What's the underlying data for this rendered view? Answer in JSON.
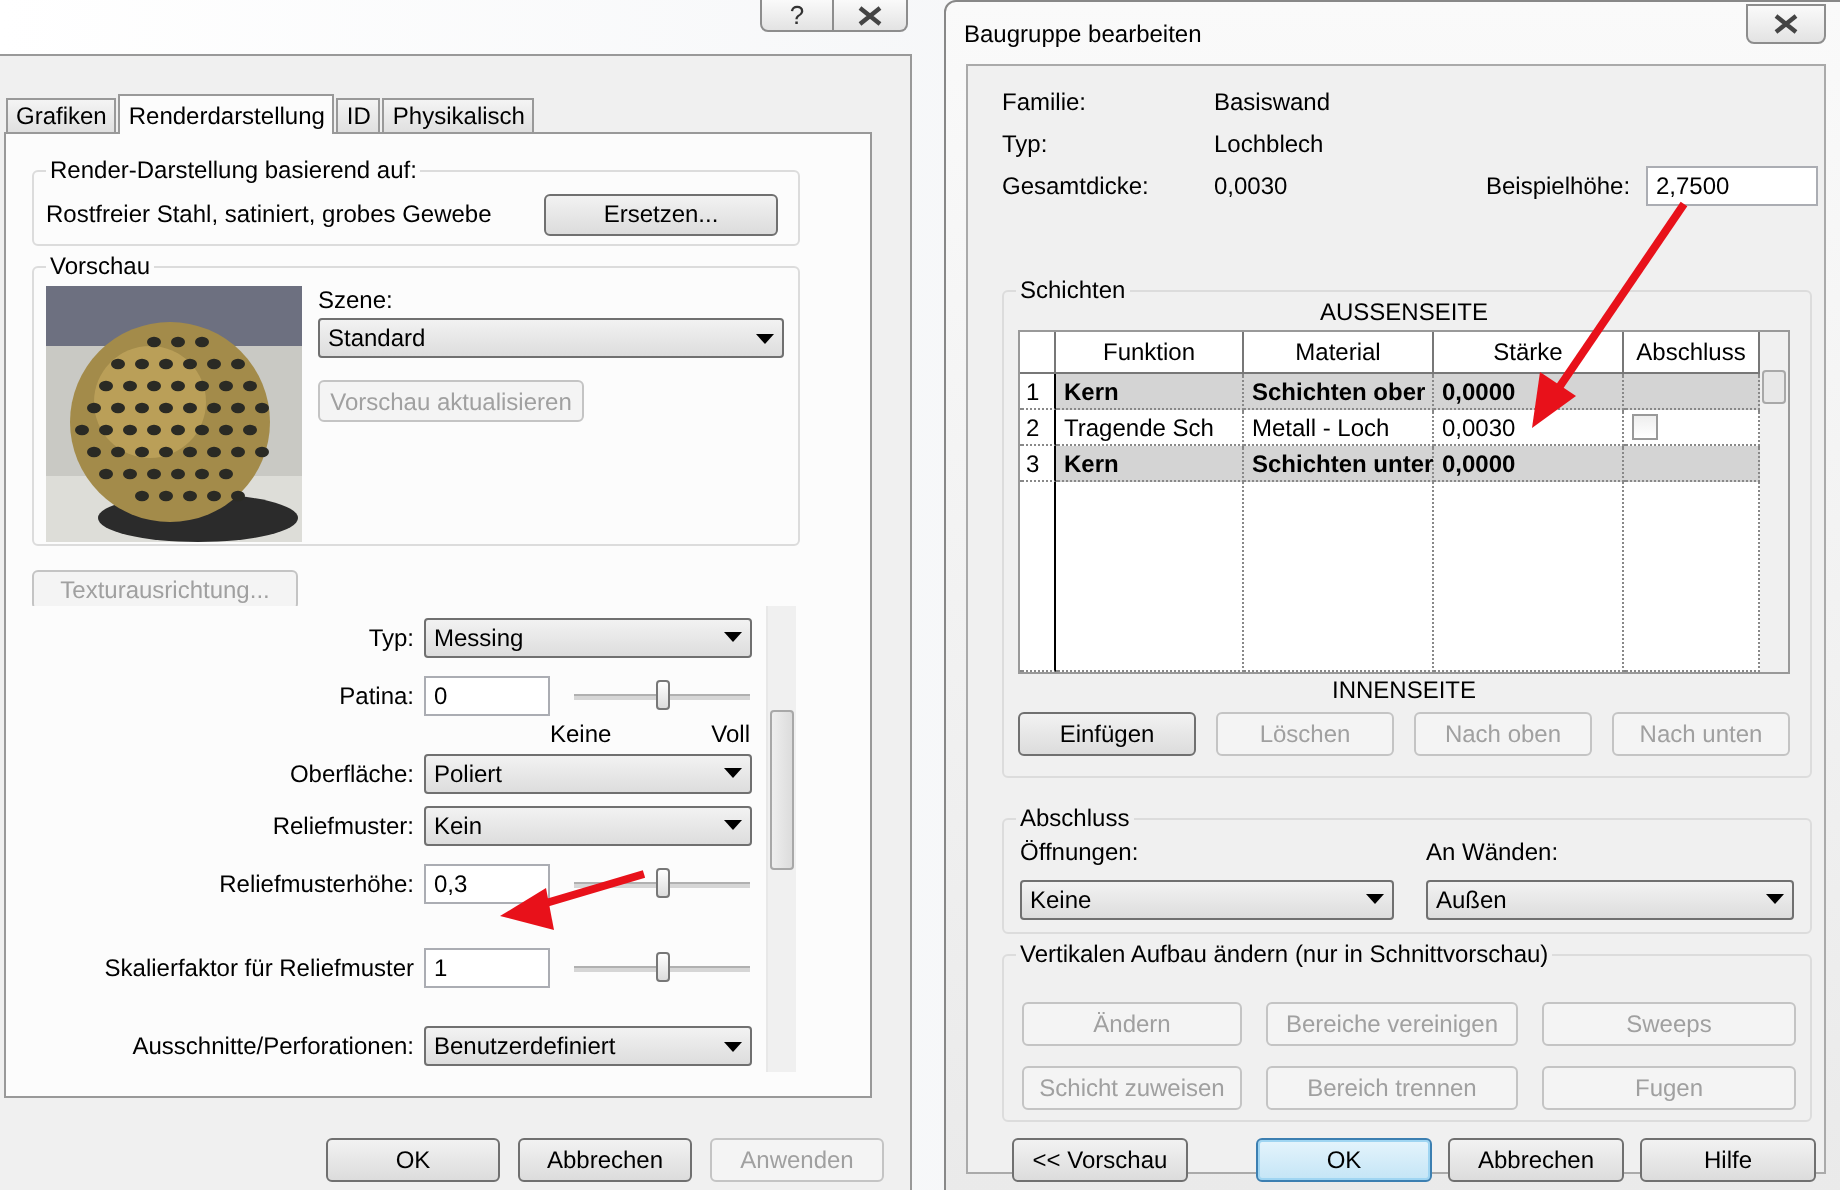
{
  "render_dialog": {
    "help_button": "?",
    "tabs": [
      {
        "label": "Grafiken",
        "selected": false
      },
      {
        "label": "Renderdarstellung",
        "selected": true
      },
      {
        "label": "ID",
        "selected": false
      },
      {
        "label": "Physikalisch",
        "selected": false
      }
    ],
    "based_on": {
      "legend": "Render-Darstellung basierend auf:",
      "value": "Rostfreier Stahl, satiniert, grobes Gewebe",
      "button": "Ersetzen..."
    },
    "preview": {
      "legend": "Vorschau",
      "scene_label": "Szene:",
      "scene": "Standard",
      "update_button": {
        "label": "Vorschau aktualisieren",
        "disabled": true
      }
    },
    "texture_button": {
      "label": "Texturausrichtung...",
      "disabled": true
    },
    "properties": [
      {
        "kind": "combo",
        "label": "Typ:",
        "value": "Messing"
      },
      {
        "kind": "slider",
        "label": "Patina:",
        "value": "0",
        "level": 0.5,
        "min_label": "Keine",
        "max_label": "Voll"
      },
      {
        "kind": "combo",
        "label": "Oberfläche:",
        "value": "Poliert"
      },
      {
        "kind": "combo",
        "label": "Reliefmuster:",
        "value": "Kein"
      },
      {
        "kind": "slider",
        "label": "Reliefmusterhöhe:",
        "value": "0,3",
        "level": 0.5
      },
      {
        "kind": "slider",
        "label": "Skalierfaktor für Reliefmuster",
        "value": "1",
        "level": 0.5
      },
      {
        "kind": "combo",
        "label": "Ausschnitte/Perforationen:",
        "value": "Benutzerdefiniert"
      }
    ],
    "buttons": [
      {
        "label": "OK",
        "disabled": false
      },
      {
        "label": "Abbrechen",
        "disabled": false
      },
      {
        "label": "Anwenden",
        "disabled": true
      }
    ]
  },
  "assembly_dialog": {
    "title": "Baugruppe bearbeiten",
    "info": [
      {
        "label": "Familie:",
        "value": "Basiswand"
      },
      {
        "label": "Typ:",
        "value": "Lochblech"
      },
      {
        "label": "Gesamtdicke:",
        "value": "0,0030"
      }
    ],
    "sample_height": {
      "label": "Beispielhöhe:",
      "value": "2,7500"
    },
    "layers": {
      "legend": "Schichten",
      "top_label": "AUSSENSEITE",
      "bottom_label": "INNENSEITE",
      "columns": [
        "Funktion",
        "Material",
        "Stärke",
        "Abschluss"
      ],
      "rows": [
        {
          "kind": "boundary",
          "number": "1",
          "function": "Kern",
          "material": "Schichten ober",
          "thickness": "0,0000"
        },
        {
          "kind": "layer",
          "number": "2",
          "function": "Tragende Sch",
          "material": "Metall - Loch",
          "thickness": "0,0030",
          "wraps": false
        },
        {
          "kind": "boundary",
          "number": "3",
          "function": "Kern",
          "material": "Schichten unter",
          "thickness": "0,0000"
        }
      ],
      "buttons": [
        {
          "label": "Einfügen",
          "disabled": false
        },
        {
          "label": "Löschen",
          "disabled": true
        },
        {
          "label": "Nach oben",
          "disabled": true
        },
        {
          "label": "Nach unten",
          "disabled": true
        }
      ]
    },
    "wrapping": {
      "legend": "Abschluss",
      "fields": [
        {
          "label": "Öffnungen:",
          "value": "Keine"
        },
        {
          "label": "An Wänden:",
          "value": "Außen"
        }
      ]
    },
    "vertical": {
      "legend": "Vertikalen Aufbau ändern (nur in Schnittvorschau)",
      "buttons": [
        {
          "label": "Ändern",
          "disabled": true
        },
        {
          "label": "Bereiche vereinigen",
          "disabled": true
        },
        {
          "label": "Sweeps",
          "disabled": true
        },
        {
          "label": "Schicht zuweisen",
          "disabled": true
        },
        {
          "label": "Bereich trennen",
          "disabled": true
        },
        {
          "label": "Fugen",
          "disabled": true
        }
      ]
    },
    "buttons": [
      {
        "label": "<< Vorschau",
        "default": false
      },
      {
        "label": "OK",
        "default": true
      },
      {
        "label": "Abbrechen",
        "default": false
      },
      {
        "label": "Hilfe",
        "default": false
      }
    ]
  }
}
